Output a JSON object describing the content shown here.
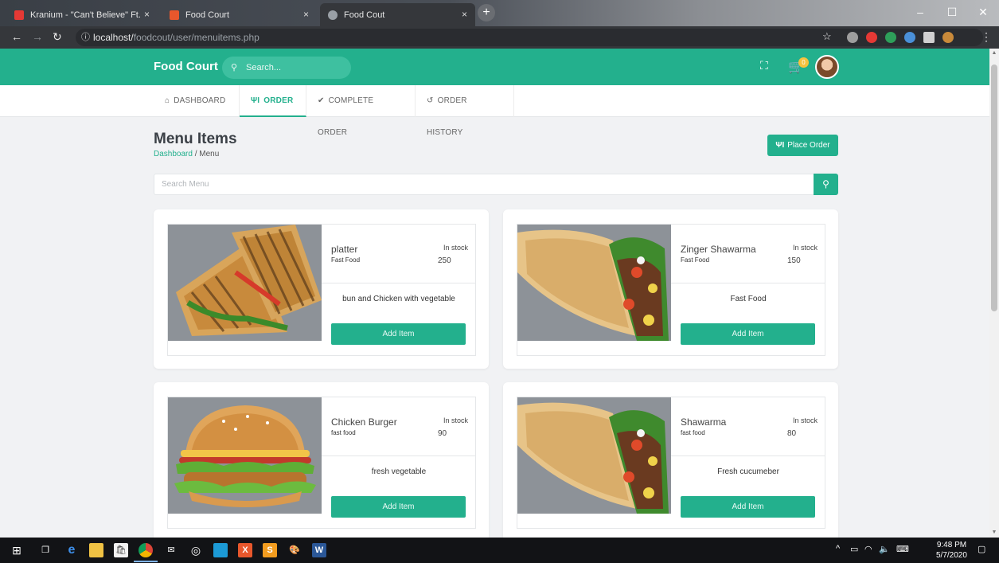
{
  "browser": {
    "tabs": [
      {
        "title": "Kranium - \"Can't Believe\" Ft.",
        "favicon_color": "#e53935"
      },
      {
        "title": "Food Court",
        "favicon_color": "#e8572c"
      },
      {
        "title": "Food Cout",
        "favicon_color": "#9aa0a6"
      }
    ],
    "url_host": "localhost/",
    "url_path": "foodcout/user/menuitems.php"
  },
  "header": {
    "brand": "Food Court",
    "search_placeholder": "Search...",
    "cart_count": "0"
  },
  "menu": {
    "items": [
      {
        "label": "DASHBOARD"
      },
      {
        "label": "ORDER"
      },
      {
        "label": "COMPLETE ORDER"
      },
      {
        "label": "ORDER HISTORY"
      }
    ]
  },
  "page": {
    "title": "Menu Items",
    "breadcrumb_link": "Dashboard",
    "breadcrumb_sep": "/",
    "breadcrumb_current": "Menu",
    "place_order_label": "Place Order",
    "search_placeholder": "Search Menu"
  },
  "stock_label": "In stock",
  "add_label": "Add Item",
  "cards": [
    {
      "name": "platter",
      "category": "Fast Food",
      "stock": "250",
      "description": "bun and Chicken with vegetable",
      "image": "sandwich"
    },
    {
      "name": "Zinger Shawarma",
      "category": "Fast Food",
      "stock": "150",
      "description": "Fast Food",
      "image": "wrap"
    },
    {
      "name": "Chicken Burger",
      "category": "fast food",
      "stock": "90",
      "description": "fresh vegetable",
      "image": "burger"
    },
    {
      "name": "Shawarma",
      "category": "fast food",
      "stock": "80",
      "description": "Fresh cucumeber",
      "image": "wrap"
    }
  ],
  "taskbar": {
    "time": "9:48 PM",
    "date": "5/7/2020"
  },
  "colors": {
    "accent": "#23b08d",
    "page_bg": "#f1f2f4"
  }
}
